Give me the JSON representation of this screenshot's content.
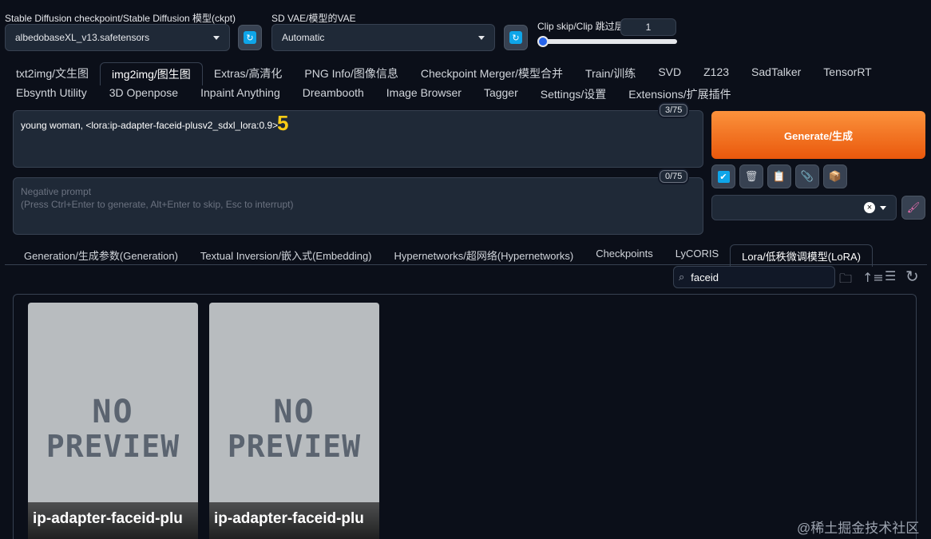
{
  "settings": {
    "checkpoint_label": "Stable Diffusion checkpoint/Stable Diffusion 模型(ckpt)",
    "checkpoint_value": "albedobaseXL_v13.safetensors",
    "vae_label": "SD VAE/模型的VAE",
    "vae_value": "Automatic",
    "clip_label": "Clip skip/Clip 跳过层",
    "clip_value": "1",
    "clip_slider_fraction": 0.0
  },
  "tabs_row1": [
    "txt2img/文生图",
    "img2img/图生图",
    "Extras/高清化",
    "PNG Info/图像信息",
    "Checkpoint Merger/模型合并",
    "Train/训练",
    "SVD",
    "Z123",
    "SadTalker",
    "TensorRT"
  ],
  "tabs_row2": [
    "Ebsynth Utility",
    "3D Openpose",
    "Inpaint Anything",
    "Dreambooth",
    "Image Browser",
    "Tagger",
    "Settings/设置",
    "Extensions/扩展插件"
  ],
  "active_tab": "img2img/图生图",
  "prompt": {
    "value": "young woman, <lora:ip-adapter-faceid-plusv2_sdxl_lora:0.9>",
    "counter": "3/75",
    "step_marker": "5"
  },
  "negative_prompt": {
    "placeholder_line1": "Negative prompt",
    "placeholder_line2": "(Press Ctrl+Enter to generate, Alt+Enter to skip, Esc to interrupt)",
    "counter": "0/75"
  },
  "generate_label": "Generate/生成",
  "tool_icons": [
    "check-icon",
    "trash-icon",
    "clipboard-icon",
    "paperclip-icon",
    "box-icon"
  ],
  "styles_clear": "×",
  "network_tabs": [
    "Generation/生成参数(Generation)",
    "Textual Inversion/嵌入式(Embedding)",
    "Hypernetworks/超网络(Hypernetworks)",
    "Checkpoints",
    "LyCORIS",
    "Lora/低秩微调模型(LoRA)"
  ],
  "active_network_tab": "Lora/低秩微调模型(LoRA)",
  "search": {
    "value": "faceid"
  },
  "cards": [
    {
      "preview_top": "NO",
      "preview_bottom": "PREVIEW",
      "name": "ip-adapter-faceid-plu"
    },
    {
      "preview_top": "NO",
      "preview_bottom": "PREVIEW",
      "name": "ip-adapter-faceid-plu"
    }
  ],
  "watermark": "@稀土掘金技术社区",
  "colors": {
    "accent": "#ea580c",
    "background": "#0b0f19",
    "panel": "#1f2937",
    "marker": "#facc15"
  }
}
